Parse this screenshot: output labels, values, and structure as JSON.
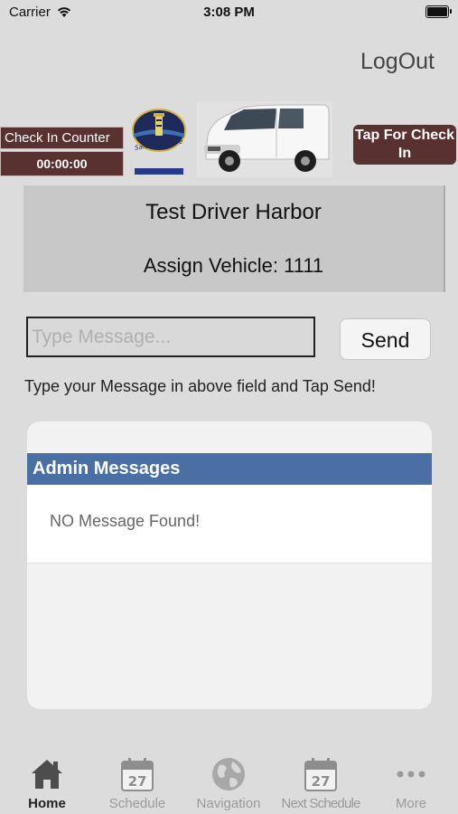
{
  "status_bar": {
    "carrier": "Carrier",
    "time": "3:08 PM"
  },
  "header": {
    "logout_label": "LogOut"
  },
  "check_in": {
    "counter_label": "Check In Counter",
    "counter_time": "00:00:00",
    "tap_label": "Tap For Check In"
  },
  "logo_text": "Safe & Reliable",
  "driver": {
    "name": "Test Driver Harbor",
    "vehicle": "Assign Vehicle: 1111"
  },
  "message": {
    "value": "",
    "placeholder": "Type Message...",
    "send_label": "Send",
    "hint": "Type your Message in above field and Tap Send!"
  },
  "admin_messages": {
    "title": "Admin Messages",
    "empty_text": "NO Message Found!"
  },
  "tabs": [
    {
      "label": "Home",
      "icon": "home-icon",
      "active": true
    },
    {
      "label": "Schedule",
      "icon": "calendar-icon",
      "day": "27"
    },
    {
      "label": "Navigation",
      "icon": "globe-icon"
    },
    {
      "label": "Next Schedule",
      "icon": "calendar-icon",
      "day": "27"
    },
    {
      "label": "More",
      "icon": "more-icon"
    }
  ],
  "colors": {
    "accent_maroon": "#5a3131",
    "header_blue": "#4a6fa5",
    "background": "#dcdcdc"
  }
}
